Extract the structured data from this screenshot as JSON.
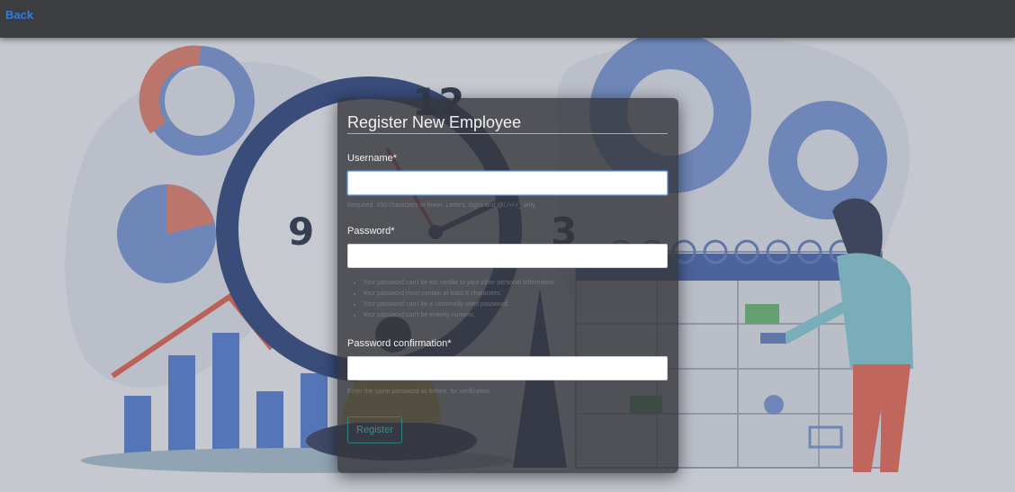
{
  "topbar": {
    "back_label": "Back"
  },
  "illustration": {
    "clock_12": "12",
    "clock_9": "9",
    "clock_3": "3"
  },
  "form": {
    "title": "Register New Employee",
    "username": {
      "label": "Username*",
      "value": "",
      "help": "Required. 150 characters or fewer. Letters, digits and @/./+/-/_ only."
    },
    "password": {
      "label": "Password*",
      "value": "",
      "help": [
        "Your password can't be too similar to your other personal information.",
        "Your password must contain at least 8 characters.",
        "Your password can't be a commonly used password.",
        "Your password can't be entirely numeric."
      ]
    },
    "password_confirmation": {
      "label": "Password confirmation*",
      "value": "",
      "help": "Enter the same password as before, for verification."
    },
    "submit_label": "Register"
  }
}
